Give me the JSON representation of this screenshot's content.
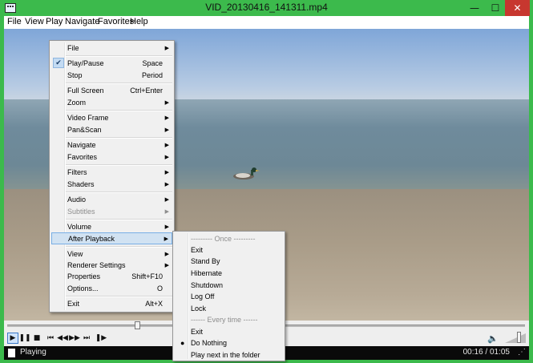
{
  "window": {
    "title": "VID_20130416_141311.mp4",
    "min_glyph": "—",
    "max_glyph": "☐",
    "close_glyph": "✕"
  },
  "menubar": [
    "File",
    "View",
    "Play",
    "Navigate",
    "Favorites",
    "Help"
  ],
  "context_menu": [
    {
      "label": "File",
      "submenu": true
    },
    {
      "label": "Play/Pause",
      "shortcut": "Space",
      "checked": true
    },
    {
      "label": "Stop",
      "shortcut": "Period"
    },
    {
      "label": "Full Screen",
      "shortcut": "Ctrl+Enter"
    },
    {
      "label": "Zoom",
      "submenu": true
    },
    {
      "label": "Video Frame",
      "submenu": true
    },
    {
      "label": "Pan&Scan",
      "submenu": true
    },
    {
      "label": "Navigate",
      "submenu": true
    },
    {
      "label": "Favorites",
      "submenu": true
    },
    {
      "label": "Filters",
      "submenu": true
    },
    {
      "label": "Shaders",
      "submenu": true
    },
    {
      "label": "Audio",
      "submenu": true
    },
    {
      "label": "Subtitles",
      "submenu": true,
      "disabled": true
    },
    {
      "label": "Volume",
      "submenu": true
    },
    {
      "label": "After Playback",
      "submenu": true,
      "highlighted": true
    },
    {
      "label": "View",
      "submenu": true
    },
    {
      "label": "Renderer Settings",
      "submenu": true
    },
    {
      "label": "Properties",
      "shortcut": "Shift+F10"
    },
    {
      "label": "Options...",
      "shortcut": "O"
    },
    {
      "label": "Exit",
      "shortcut": "Alt+X"
    }
  ],
  "after_playback_menu": [
    {
      "label": "--------- Once ---------",
      "header": true
    },
    {
      "label": "Exit"
    },
    {
      "label": "Stand By"
    },
    {
      "label": "Hibernate"
    },
    {
      "label": "Shutdown"
    },
    {
      "label": "Log Off"
    },
    {
      "label": "Lock"
    },
    {
      "label": "------ Every time ------",
      "header": true
    },
    {
      "label": "Exit"
    },
    {
      "label": "Do Nothing",
      "selected": true
    },
    {
      "label": "Play next in the folder"
    }
  ],
  "controls": {
    "play_glyph": "▶",
    "pause_glyph": "❚❚",
    "stop_glyph": "■",
    "prev_glyph": "⏮",
    "rewind_glyph": "◀◀",
    "forward_glyph": "▶▶",
    "next_glyph": "⏭",
    "frame_step_glyph": "❚▶",
    "volume_glyph": "🔈",
    "seek_fraction": 0.25,
    "volume_fraction": 0.65
  },
  "status": {
    "state": "Playing",
    "time": "00:16 / 01:05",
    "grip_glyph": "⋰"
  },
  "colors": {
    "frame": "#3cba4c",
    "close": "#c7372f",
    "menu_highlight": "#d1e2f2"
  }
}
